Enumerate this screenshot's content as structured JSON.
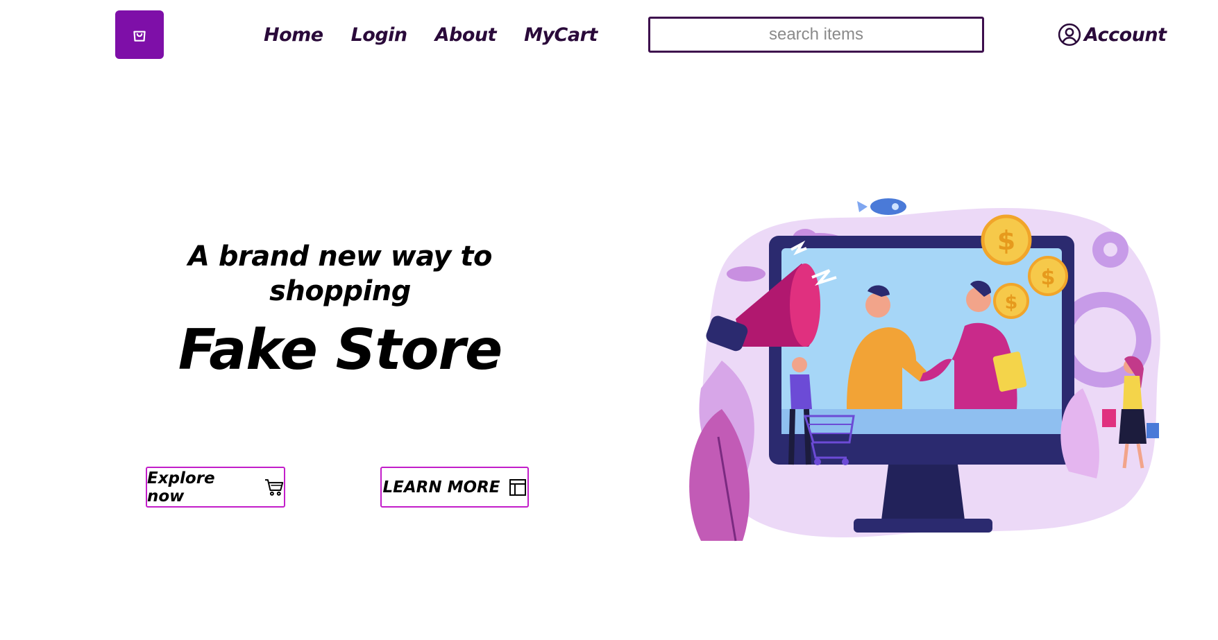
{
  "header": {
    "logo_icon": "shopping-bag-icon",
    "nav": [
      {
        "label": "Home"
      },
      {
        "label": "Login"
      },
      {
        "label": "About"
      },
      {
        "label": "MyCart"
      }
    ],
    "search": {
      "placeholder": "search items",
      "value": ""
    },
    "account": {
      "label": "Account",
      "icon": "user-circle-icon"
    }
  },
  "hero": {
    "tagline": "A brand new way to shopping",
    "store_name": "Fake Store",
    "buttons": {
      "explore": {
        "label": "Explore now",
        "icon": "cart-icon"
      },
      "learn": {
        "label": "LEARN MORE",
        "icon": "layout-icon"
      }
    },
    "illustration": "online-shopping-illustration"
  },
  "colors": {
    "brand": "#7e0fa8",
    "nav_text": "#2a0a3a",
    "button_border": "#c21dc9"
  }
}
